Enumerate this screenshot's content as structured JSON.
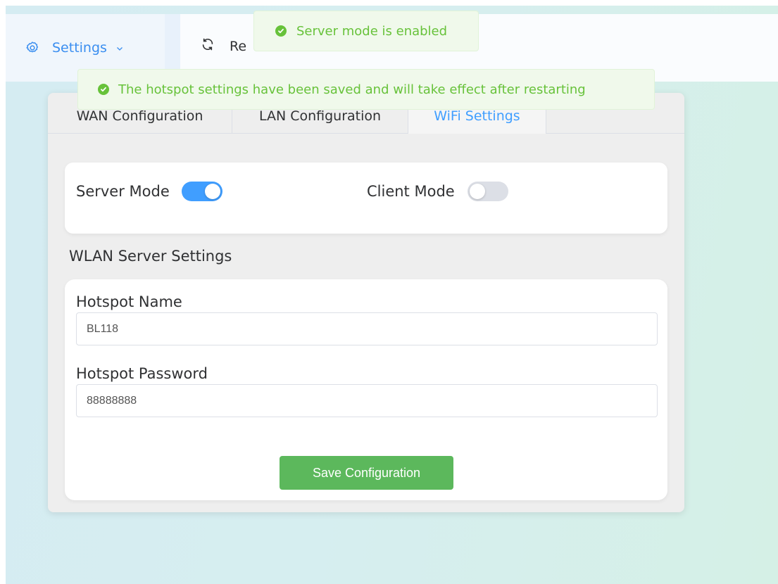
{
  "header": {
    "settings_menu_label": "Settings",
    "refresh_label": "Re"
  },
  "toasts": {
    "mode_toast": "Server mode is enabled",
    "saved_toast": "The hotspot settings have been saved and will take effect after restarting"
  },
  "tabs": [
    {
      "label": "WAN Configuration",
      "active": false
    },
    {
      "label": "LAN Configuration",
      "active": false
    },
    {
      "label": "WiFi Settings",
      "active": true
    }
  ],
  "modes": {
    "server_label": "Server Mode",
    "server_enabled": true,
    "client_label": "Client Mode",
    "client_enabled": false
  },
  "wlan": {
    "section_title": "WLAN Server Settings",
    "name_label": "Hotspot Name",
    "name_value": "BL118",
    "password_label": "Hotspot Password",
    "password_value": "88888888",
    "save_label": "Save Configuration"
  },
  "colors": {
    "accent": "#409eff",
    "success": "#67c23a",
    "save_button": "#5cb85c"
  },
  "icons": {
    "settings": "gear-icon",
    "dropdown": "chevron-down-icon",
    "refresh": "refresh-icon",
    "toast": "check-circle-icon"
  }
}
